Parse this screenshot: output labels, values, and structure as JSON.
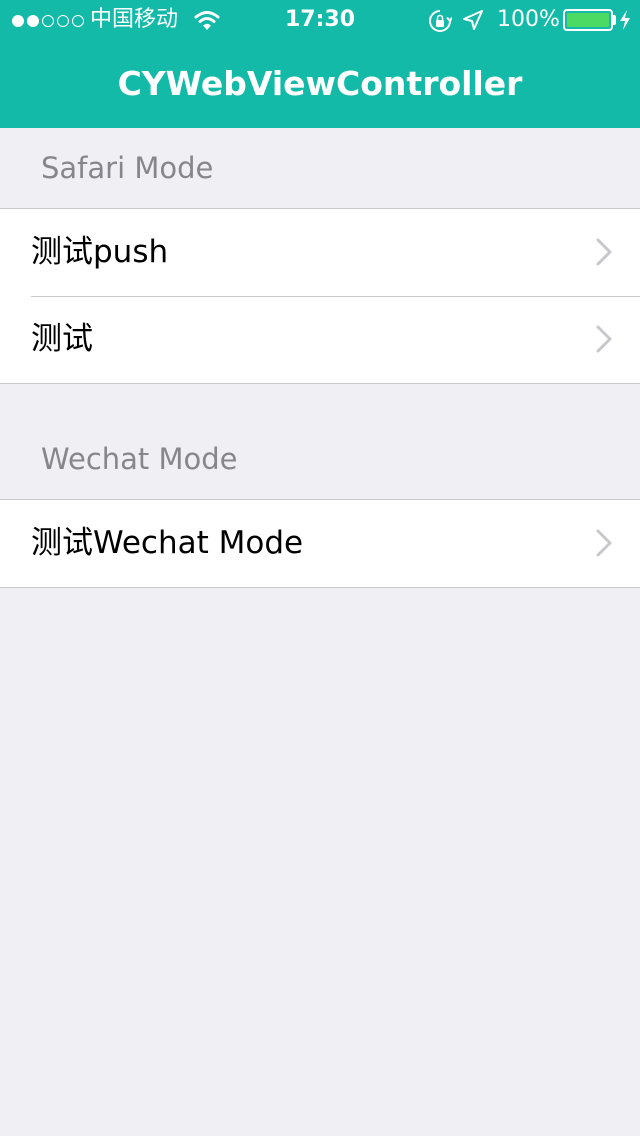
{
  "status_bar": {
    "carrier": "中国移动",
    "time": "17:30",
    "battery_percent": "100%",
    "battery_level": 1.0,
    "signal_bars_filled": 2,
    "signal_bars_total": 5,
    "icons": [
      "wifi-icon",
      "orientation-lock-icon",
      "location-icon",
      "battery-icon",
      "charging-icon"
    ]
  },
  "nav": {
    "title": "CYWebViewController"
  },
  "sections": [
    {
      "header": "Safari Mode",
      "items": [
        {
          "label": "测试push"
        },
        {
          "label": "测试"
        }
      ]
    },
    {
      "header": "Wechat Mode",
      "items": [
        {
          "label": "测试Wechat Mode"
        }
      ]
    }
  ],
  "colors": {
    "nav_background": "#12baa7",
    "page_background": "#efeff4",
    "section_header_text": "#86868b",
    "separator": "#c8c7cc",
    "battery_fill": "#4cd964",
    "chevron": "#c7c7cc"
  }
}
